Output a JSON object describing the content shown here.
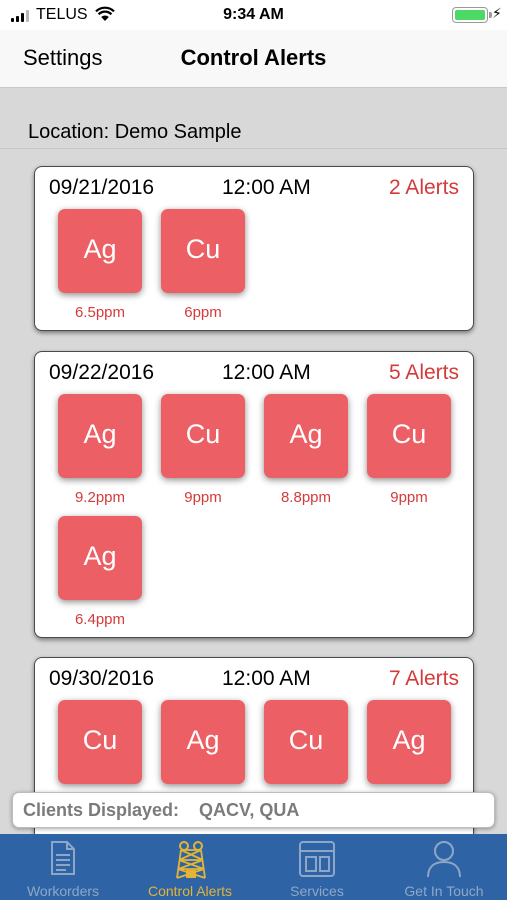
{
  "status_bar": {
    "carrier": "TELUS",
    "time": "9:34 AM",
    "battery_charging_symbol": "⚡"
  },
  "nav": {
    "back_label": "Settings",
    "title": "Control Alerts"
  },
  "location_label": "Location: Demo Sample",
  "cards": [
    {
      "date": "09/21/2016",
      "time": "12:00 AM",
      "alerts": "2 Alerts",
      "tiles": [
        {
          "element": "Ag",
          "value": "6.5ppm"
        },
        {
          "element": "Cu",
          "value": "6ppm"
        }
      ]
    },
    {
      "date": "09/22/2016",
      "time": "12:00 AM",
      "alerts": "5 Alerts",
      "tiles": [
        {
          "element": "Ag",
          "value": "9.2ppm"
        },
        {
          "element": "Cu",
          "value": "9ppm"
        },
        {
          "element": "Ag",
          "value": "8.8ppm"
        },
        {
          "element": "Cu",
          "value": "9ppm"
        },
        {
          "element": "Ag",
          "value": "6.4ppm"
        }
      ]
    },
    {
      "date": "09/30/2016",
      "time": "12:00 AM",
      "alerts": "7 Alerts",
      "tiles": [
        {
          "element": "Cu"
        },
        {
          "element": "Ag"
        },
        {
          "element": "Cu"
        },
        {
          "element": "Ag"
        }
      ]
    }
  ],
  "clients": {
    "label": "Clients Displayed:",
    "value": "QACV, QUA"
  },
  "tabs": [
    {
      "label": "Workorders",
      "icon": "document-icon"
    },
    {
      "label": "Control Alerts",
      "icon": "mine-headframe-icon",
      "active": true
    },
    {
      "label": "Services",
      "icon": "layout-icon"
    },
    {
      "label": "Get In Touch",
      "icon": "person-icon"
    }
  ],
  "colors": {
    "alert_red": "#d53a3a",
    "tile_red": "#ec5f64",
    "tab_bar": "#2e64a5",
    "tab_active": "#e3b436",
    "tab_inactive": "#8fa7c7"
  }
}
